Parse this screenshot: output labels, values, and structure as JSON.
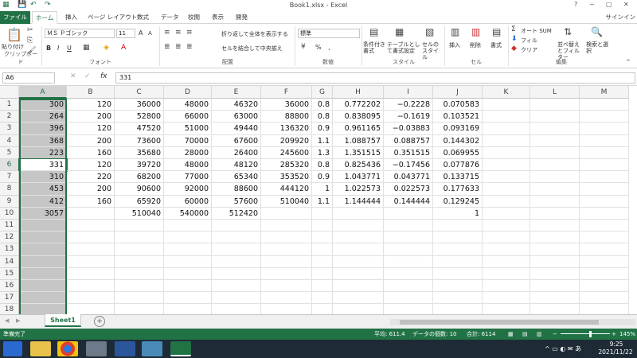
{
  "title_bar": {
    "title": "Book1.xlsx - Excel",
    "help": "?",
    "minimize": "─",
    "restore": "▢",
    "close": "✕"
  },
  "tabs": [
    "ファイル",
    "ホーム",
    "挿入",
    "ページ レイアウト",
    "数式",
    "データ",
    "校閲",
    "表示",
    "開発"
  ],
  "signin": "サインイン",
  "ribbon": {
    "clipboard": {
      "paste": "貼り付け",
      "label": "クリップボード"
    },
    "font": {
      "name": "ＭＳ Ｐゴシック",
      "size": "11",
      "grow": "A",
      "shrink": "A",
      "bold": "B",
      "italic": "I",
      "underline": "U",
      "label": "フォント"
    },
    "alignment": {
      "wrap": "折り返して全体を表示する",
      "merge": "セルを結合して中央揃え",
      "label": "配置"
    },
    "number": {
      "format": "標準",
      "percent": "%",
      "comma": ",",
      "label": "数値"
    },
    "styles": {
      "conditional": "条件付き書式",
      "table": "テーブルとして書式設定",
      "cell": "セルのスタイル",
      "label": "スタイル"
    },
    "cells": {
      "insert": "挿入",
      "delete": "削除",
      "format": "書式",
      "label": "セル"
    },
    "editing": {
      "autosum": "オート SUM",
      "fill": "フィル",
      "clear": "クリア",
      "sort": "並べ替えとフィルター",
      "find": "検索と選択",
      "label": "編集"
    }
  },
  "formula_bar": {
    "name_box": "A6",
    "fx": "fx",
    "value": "331"
  },
  "columns": [
    "A",
    "B",
    "C",
    "D",
    "E",
    "F",
    "G",
    "H",
    "I",
    "J",
    "K",
    "L",
    "M"
  ],
  "rows": [
    [
      "300",
      "120",
      "36000",
      "48000",
      "46320",
      "36000",
      "0.8",
      "0.772202",
      "−0.2228",
      "0.070583",
      "",
      "",
      ""
    ],
    [
      "264",
      "200",
      "52800",
      "66000",
      "63000",
      "88800",
      "0.8",
      "0.838095",
      "−0.1619",
      "0.103521",
      "",
      "",
      ""
    ],
    [
      "396",
      "120",
      "47520",
      "51000",
      "49440",
      "136320",
      "0.9",
      "0.961165",
      "−0.03883",
      "0.093169",
      "",
      "",
      ""
    ],
    [
      "368",
      "200",
      "73600",
      "70000",
      "67600",
      "209920",
      "1.1",
      "1.088757",
      "0.088757",
      "0.144302",
      "",
      "",
      ""
    ],
    [
      "223",
      "160",
      "35680",
      "28000",
      "26400",
      "245600",
      "1.3",
      "1.351515",
      "0.351515",
      "0.069955",
      "",
      "",
      ""
    ],
    [
      "331",
      "120",
      "39720",
      "48000",
      "48120",
      "285320",
      "0.8",
      "0.825436",
      "−0.17456",
      "0.077876",
      "",
      "",
      ""
    ],
    [
      "310",
      "220",
      "68200",
      "77000",
      "65340",
      "353520",
      "0.9",
      "1.043771",
      "0.043771",
      "0.133715",
      "",
      "",
      ""
    ],
    [
      "453",
      "200",
      "90600",
      "92000",
      "88600",
      "444120",
      "1",
      "1.022573",
      "0.022573",
      "0.177633",
      "",
      "",
      ""
    ],
    [
      "412",
      "160",
      "65920",
      "60000",
      "57600",
      "510040",
      "1.1",
      "1.144444",
      "0.144444",
      "0.129245",
      "",
      "",
      ""
    ],
    [
      "3057",
      "",
      "510040",
      "540000",
      "512420",
      "",
      "",
      "",
      "",
      "1",
      "",
      "",
      ""
    ],
    [
      "",
      "",
      "",
      "",
      "",
      "",
      "",
      "",
      "",
      "",
      "",
      "",
      ""
    ],
    [
      "",
      "",
      "",
      "",
      "",
      "",
      "",
      "",
      "",
      "",
      "",
      "",
      ""
    ],
    [
      "",
      "",
      "",
      "",
      "",
      "",
      "",
      "",
      "",
      "",
      "",
      "",
      ""
    ],
    [
      "",
      "",
      "",
      "",
      "",
      "",
      "",
      "",
      "",
      "",
      "",
      "",
      ""
    ],
    [
      "",
      "",
      "",
      "",
      "",
      "",
      "",
      "",
      "",
      "",
      "",
      "",
      ""
    ],
    [
      "",
      "",
      "",
      "",
      "",
      "",
      "",
      "",
      "",
      "",
      "",
      "",
      ""
    ],
    [
      "",
      "",
      "",
      "",
      "",
      "",
      "",
      "",
      "",
      "",
      "",
      "",
      ""
    ],
    [
      "",
      "",
      "",
      "",
      "",
      "",
      "",
      "",
      "",
      "",
      "",
      "",
      ""
    ],
    [
      "",
      "",
      "",
      "",
      "",
      "",
      "",
      "",
      "",
      "",
      "",
      "",
      ""
    ]
  ],
  "sheet_tab": "Sheet1",
  "add_sheet": "+",
  "status": {
    "ready": "準備完了",
    "average": "平均: 611.4",
    "count": "データの個数: 10",
    "sum": "合計: 6114",
    "zoom": "145%"
  },
  "taskbar": {
    "time": "9:25",
    "date": "2021/11/22"
  }
}
